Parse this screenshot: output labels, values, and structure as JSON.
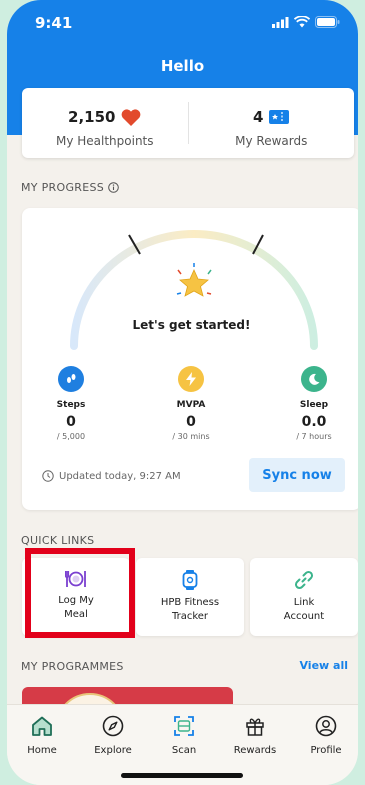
{
  "status_bar": {
    "time": "9:41"
  },
  "header": {
    "greeting": "Hello"
  },
  "summary": {
    "healthpoints_value": "2,150",
    "healthpoints_label": "My Healthpoints",
    "rewards_value": "4",
    "rewards_label": "My Rewards"
  },
  "progress": {
    "section_title": "MY PROGRESS",
    "headline": "Let's get started!",
    "metrics": [
      {
        "name": "Steps",
        "value": "0",
        "unit": "/ 5,000",
        "color": "#1f7fe0"
      },
      {
        "name": "MVPA",
        "value": "0",
        "unit": "/ 30 mins",
        "color": "#f6c343"
      },
      {
        "name": "Sleep",
        "value": "0.0",
        "unit": "/ 7 hours",
        "color": "#3cb48c"
      }
    ],
    "updated_text": "Updated today, 9:27 AM",
    "sync_button": "Sync now"
  },
  "quick_links": {
    "section_title": "QUICK LINKS",
    "items": [
      {
        "label_line1": "Log My",
        "label_line2": "Meal",
        "icon": "plate-icon"
      },
      {
        "label_line1": "HPB Fitness",
        "label_line2": "Tracker",
        "icon": "watch-icon"
      },
      {
        "label_line1": "Link",
        "label_line2": "Account",
        "icon": "link-icon"
      }
    ]
  },
  "programmes": {
    "section_title": "MY PROGRAMMES",
    "view_all": "View all"
  },
  "tab_bar": {
    "tabs": [
      {
        "label": "Home",
        "icon": "home-icon"
      },
      {
        "label": "Explore",
        "icon": "compass-icon"
      },
      {
        "label": "Scan",
        "icon": "scan-icon"
      },
      {
        "label": "Rewards",
        "icon": "gift-icon"
      },
      {
        "label": "Profile",
        "icon": "profile-icon"
      }
    ]
  },
  "colors": {
    "brand_blue": "#1681e8",
    "highlight_red": "#e2001a",
    "heart_red": "#e24a2c"
  }
}
